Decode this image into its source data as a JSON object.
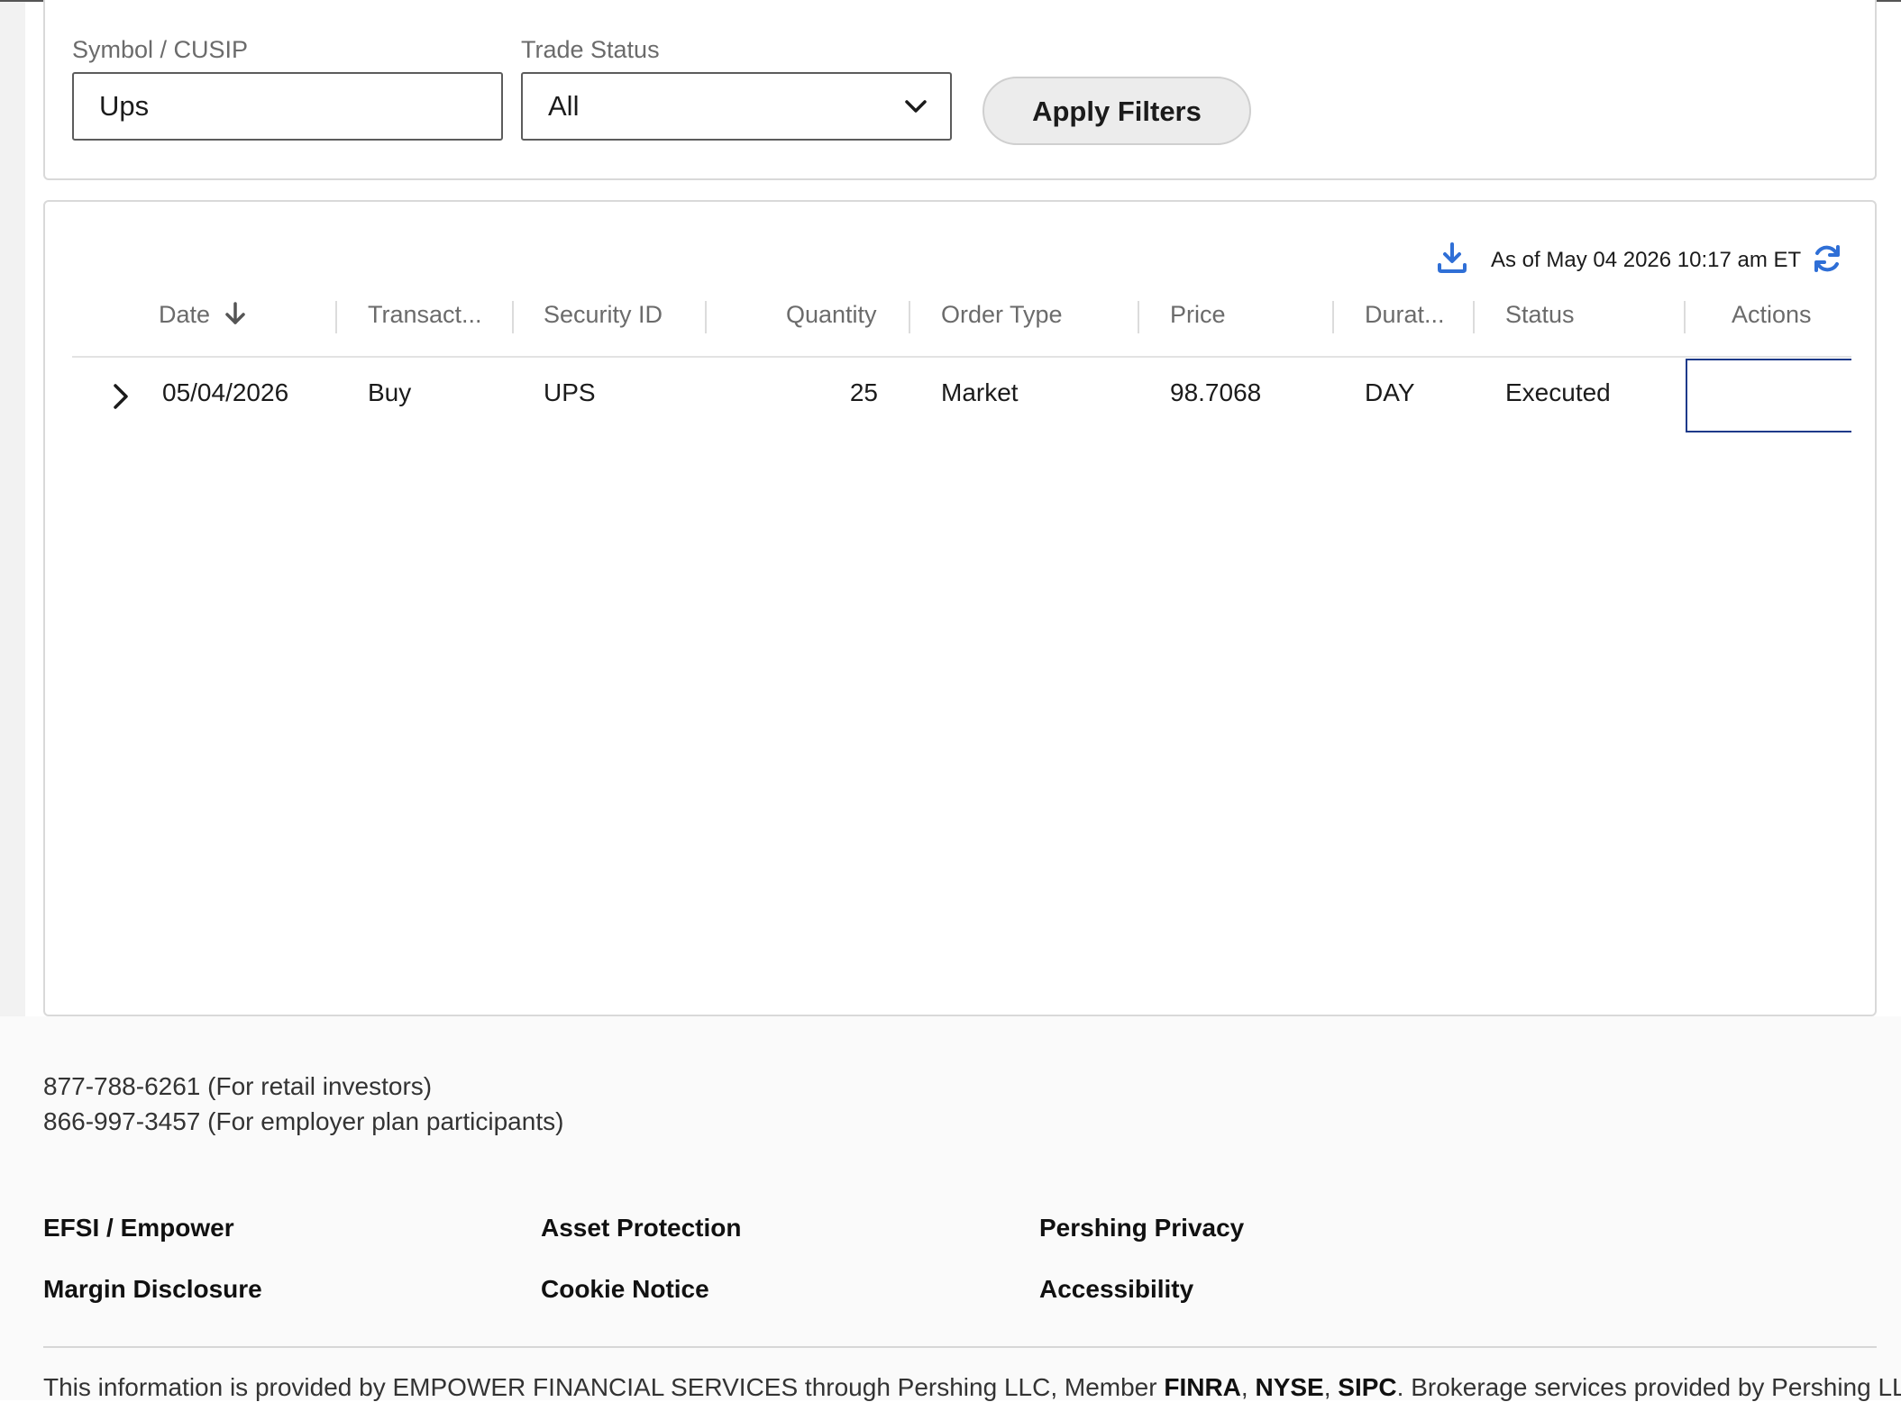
{
  "filters": {
    "symbol_label": "Symbol / CUSIP",
    "symbol_value": "Ups",
    "status_label": "Trade Status",
    "status_value": "All",
    "apply_label": "Apply Filters"
  },
  "results": {
    "as_of": "As of May 04 2026 10:17 am ET",
    "columns": {
      "date": "Date",
      "transaction": "Transact...",
      "security_id": "Security ID",
      "quantity": "Quantity",
      "order_type": "Order Type",
      "price": "Price",
      "duration": "Durat...",
      "status": "Status",
      "actions": "Actions"
    },
    "rows": [
      {
        "date": "05/04/2026",
        "transaction": "Buy",
        "security_id": "UPS",
        "quantity": "25",
        "order_type": "Market",
        "price": "98.7068",
        "duration": "DAY",
        "status": "Executed"
      }
    ]
  },
  "footer": {
    "phone_retail": "877-788-6261 (For retail investors)",
    "phone_employer": "866-997-3457 (For employer plan participants)",
    "links": {
      "efsi": "EFSI / Empower",
      "asset_protection": "Asset Protection",
      "pershing_privacy": "Pershing Privacy",
      "margin_disclosure": "Margin Disclosure",
      "cookie_notice": "Cookie Notice",
      "accessibility": "Accessibility"
    },
    "disclaimer": {
      "lead": "This information is provided by EMPOWER FINANCIAL SERVICES through Pershing LLC, Member ",
      "finra": "FINRA",
      "comma1": ", ",
      "nyse": "NYSE",
      "comma2": ", ",
      "sipc": "SIPC",
      "tail": ". Brokerage services provided by Pershing LLC and"
    }
  }
}
